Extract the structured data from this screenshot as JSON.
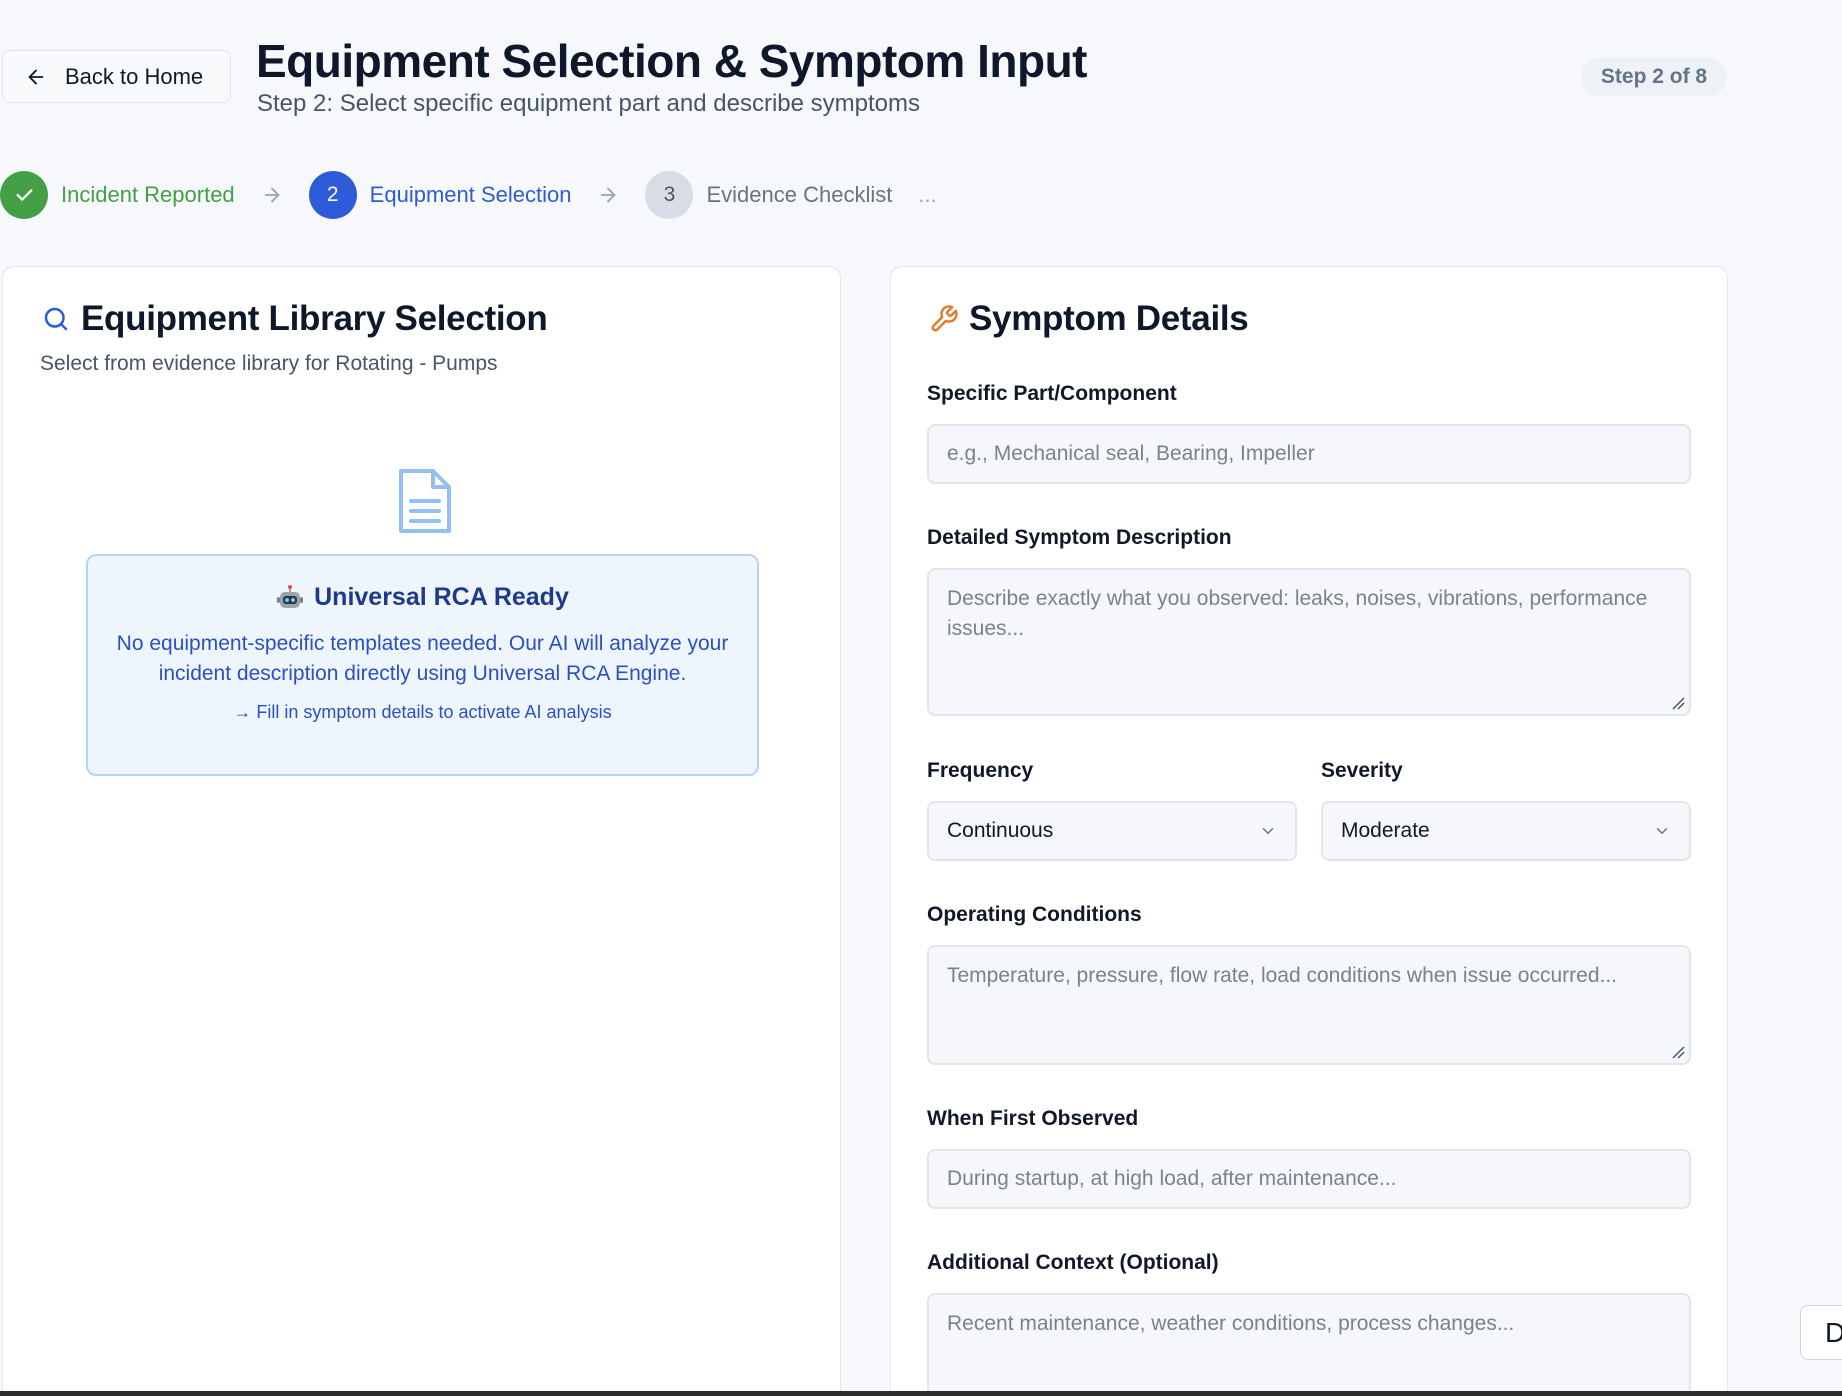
{
  "header": {
    "back_label": "Back to Home",
    "title": "Equipment Selection & Symptom Input",
    "subtitle": "Step 2: Select specific equipment part and describe symptoms",
    "step_badge": "Step 2 of 8"
  },
  "stepper": {
    "steps": [
      {
        "number": "✓",
        "label": "Incident Reported",
        "state": "done"
      },
      {
        "number": "2",
        "label": "Equipment Selection",
        "state": "active"
      },
      {
        "number": "3",
        "label": "Evidence Checklist",
        "state": "pending"
      }
    ],
    "more": "..."
  },
  "library": {
    "title": "Equipment Library Selection",
    "description": "Select from evidence library for Rotating - Pumps",
    "rca_heading": "Universal RCA Ready",
    "rca_body": "No equipment-specific templates needed. Our AI will analyze your incident description directly using Universal RCA Engine.",
    "rca_hint": "→ Fill in symptom details to activate AI analysis"
  },
  "symptoms": {
    "title": "Symptom Details",
    "part_label": "Specific Part/Component",
    "part_placeholder": "e.g., Mechanical seal, Bearing, Impeller",
    "description_label": "Detailed Symptom Description",
    "description_placeholder": "Describe exactly what you observed: leaks, noises, vibrations, performance issues...",
    "frequency_label": "Frequency",
    "frequency_value": "Continuous",
    "severity_label": "Severity",
    "severity_value": "Moderate",
    "operating_label": "Operating Conditions",
    "operating_placeholder": "Temperature, pressure, flow rate, load conditions when issue occurred...",
    "first_observed_label": "When First Observed",
    "first_observed_placeholder": "During startup, at high load, after maintenance...",
    "context_label": "Additional Context (Optional)",
    "context_placeholder": "Recent maintenance, weather conditions, process changes..."
  },
  "side_tab": "D",
  "colors": {
    "primary": "#2e5bd8",
    "success": "#43a047",
    "accent_orange": "#e07a2f"
  }
}
